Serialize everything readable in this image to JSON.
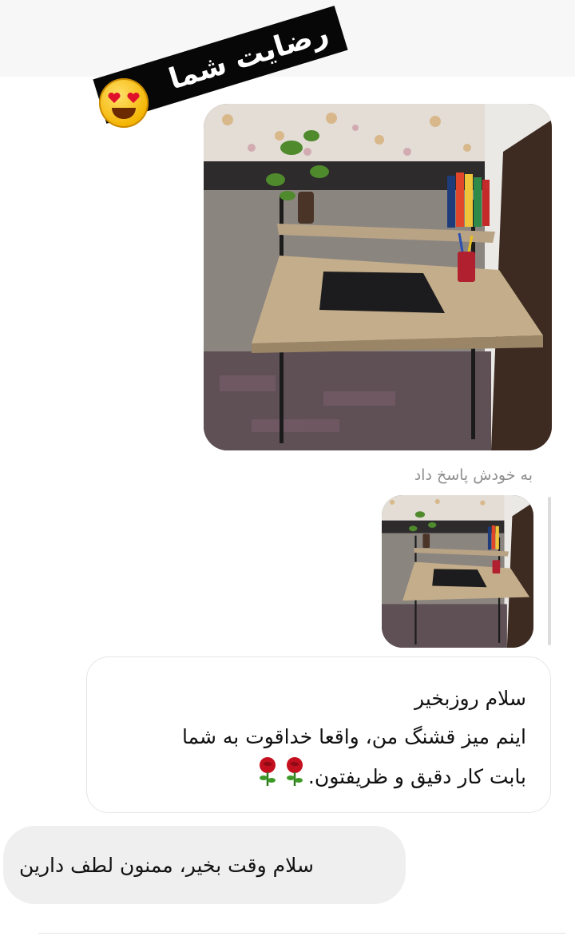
{
  "post": {
    "banner_text": "رضایت شما",
    "emoji_icon": "heart-eyes-emoji"
  },
  "chat": {
    "reply_caption": "به خودش پاسخ داد",
    "incoming_message": {
      "lines": [
        "سلام روزبخیر",
        "اینم میز قشنگ من، واقعا خداقوت به شما",
        "بابت کار دقیق و ظریفتون."
      ],
      "trailing_icons": [
        "rose-icon",
        "rose-icon"
      ]
    },
    "outgoing_message": "سلام وقت بخیر، ممنون لطف دارین"
  }
}
